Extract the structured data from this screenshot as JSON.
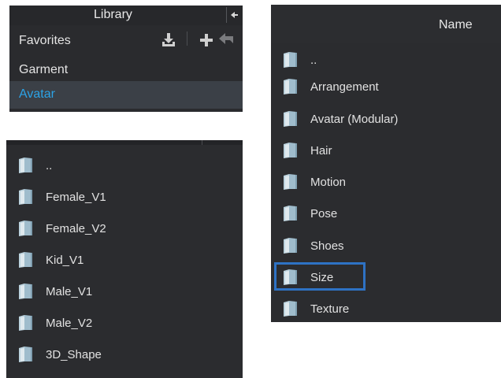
{
  "library": {
    "title": "Library",
    "rows": [
      "Favorites",
      "Garment",
      "Avatar"
    ],
    "selected_row": "Avatar",
    "selected_color": "#2ca3e6"
  },
  "icons": {
    "folder": "folder-icon",
    "download": "download-icon",
    "add": "plus-icon",
    "back": "back-arrow-icon",
    "collapse": "collapse-arrow-icon"
  },
  "left_list": {
    "items": [
      "..",
      "Female_V1",
      "Female_V2",
      "Kid_V1",
      "Male_V1",
      "Male_V2",
      "3D_Shape"
    ]
  },
  "right_list": {
    "column_header": "Name",
    "items": [
      "..",
      "Arrangement",
      "Avatar (Modular)",
      "Hair",
      "Motion",
      "Pose",
      "Shoes",
      "Size",
      "Texture"
    ],
    "highlighted_item": "Size",
    "highlight_color": "#2e72c4"
  }
}
